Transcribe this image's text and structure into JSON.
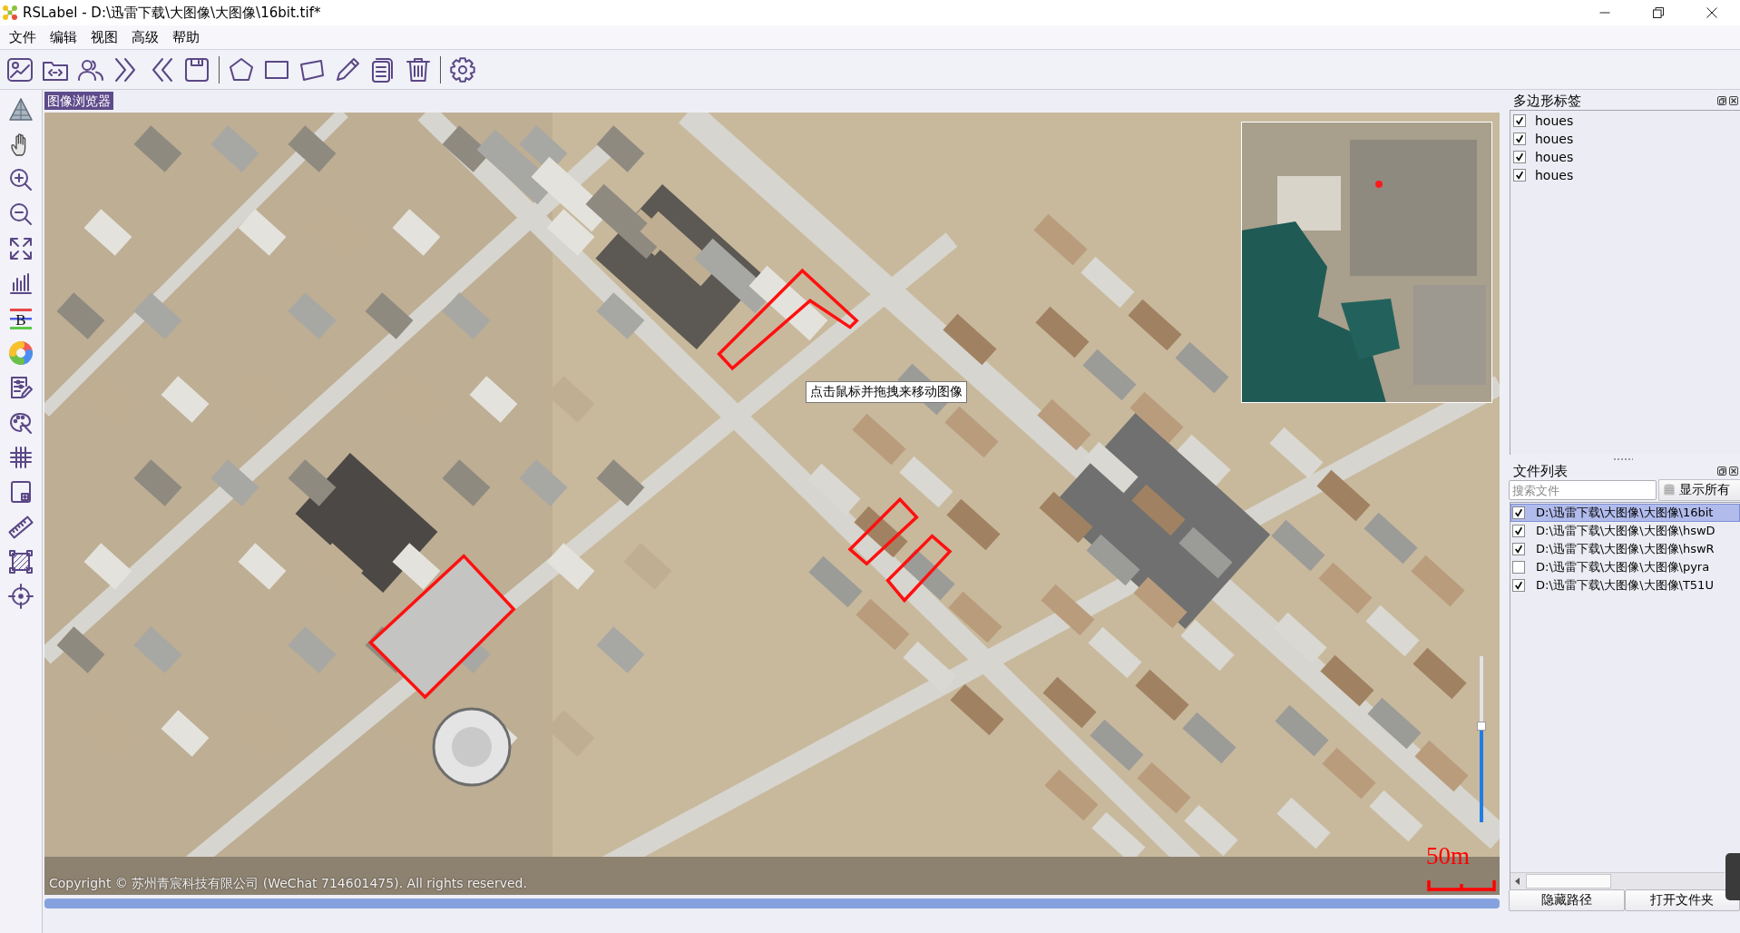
{
  "window": {
    "title": "RSLabel - D:\\迅雷下载\\大图像\\大图像\\16bit.tif*"
  },
  "menu": [
    "文件",
    "编辑",
    "视图",
    "高级",
    "帮助"
  ],
  "tool_column": {
    "band_glyph": "B"
  },
  "viewer": {
    "title": "图像浏览器",
    "tooltip": "点击鼠标并拖拽来移动图像",
    "copyright": "Copyright © 苏州青宸科技有限公司 (WeChat 714601475). All rights reserved.",
    "scale_label": "50m",
    "zoom_slider": {
      "level": 0.58
    }
  },
  "label_panel": {
    "title": "多边形标签",
    "items": [
      {
        "label": "houes",
        "checked": true
      },
      {
        "label": "houes",
        "checked": true
      },
      {
        "label": "houes",
        "checked": true
      },
      {
        "label": "houes",
        "checked": true
      }
    ]
  },
  "file_panel": {
    "title": "文件列表",
    "search": {
      "placeholder": "搜索文件"
    },
    "show_all_button": "显示所有",
    "files": [
      {
        "path": "D:\\迅雷下载\\大图像\\大图像\\16bit",
        "checked": true,
        "selected": true
      },
      {
        "path": "D:\\迅雷下载\\大图像\\大图像\\hswD",
        "checked": true,
        "selected": false
      },
      {
        "path": "D:\\迅雷下载\\大图像\\大图像\\hswR",
        "checked": true,
        "selected": false
      },
      {
        "path": "D:\\迅雷下载\\大图像\\大图像\\pyra",
        "checked": false,
        "selected": false
      },
      {
        "path": "D:\\迅雷下载\\大图像\\大图像\\T51U",
        "checked": true,
        "selected": false
      }
    ],
    "buttons": [
      "隐藏路径",
      "打开文件夹"
    ]
  }
}
